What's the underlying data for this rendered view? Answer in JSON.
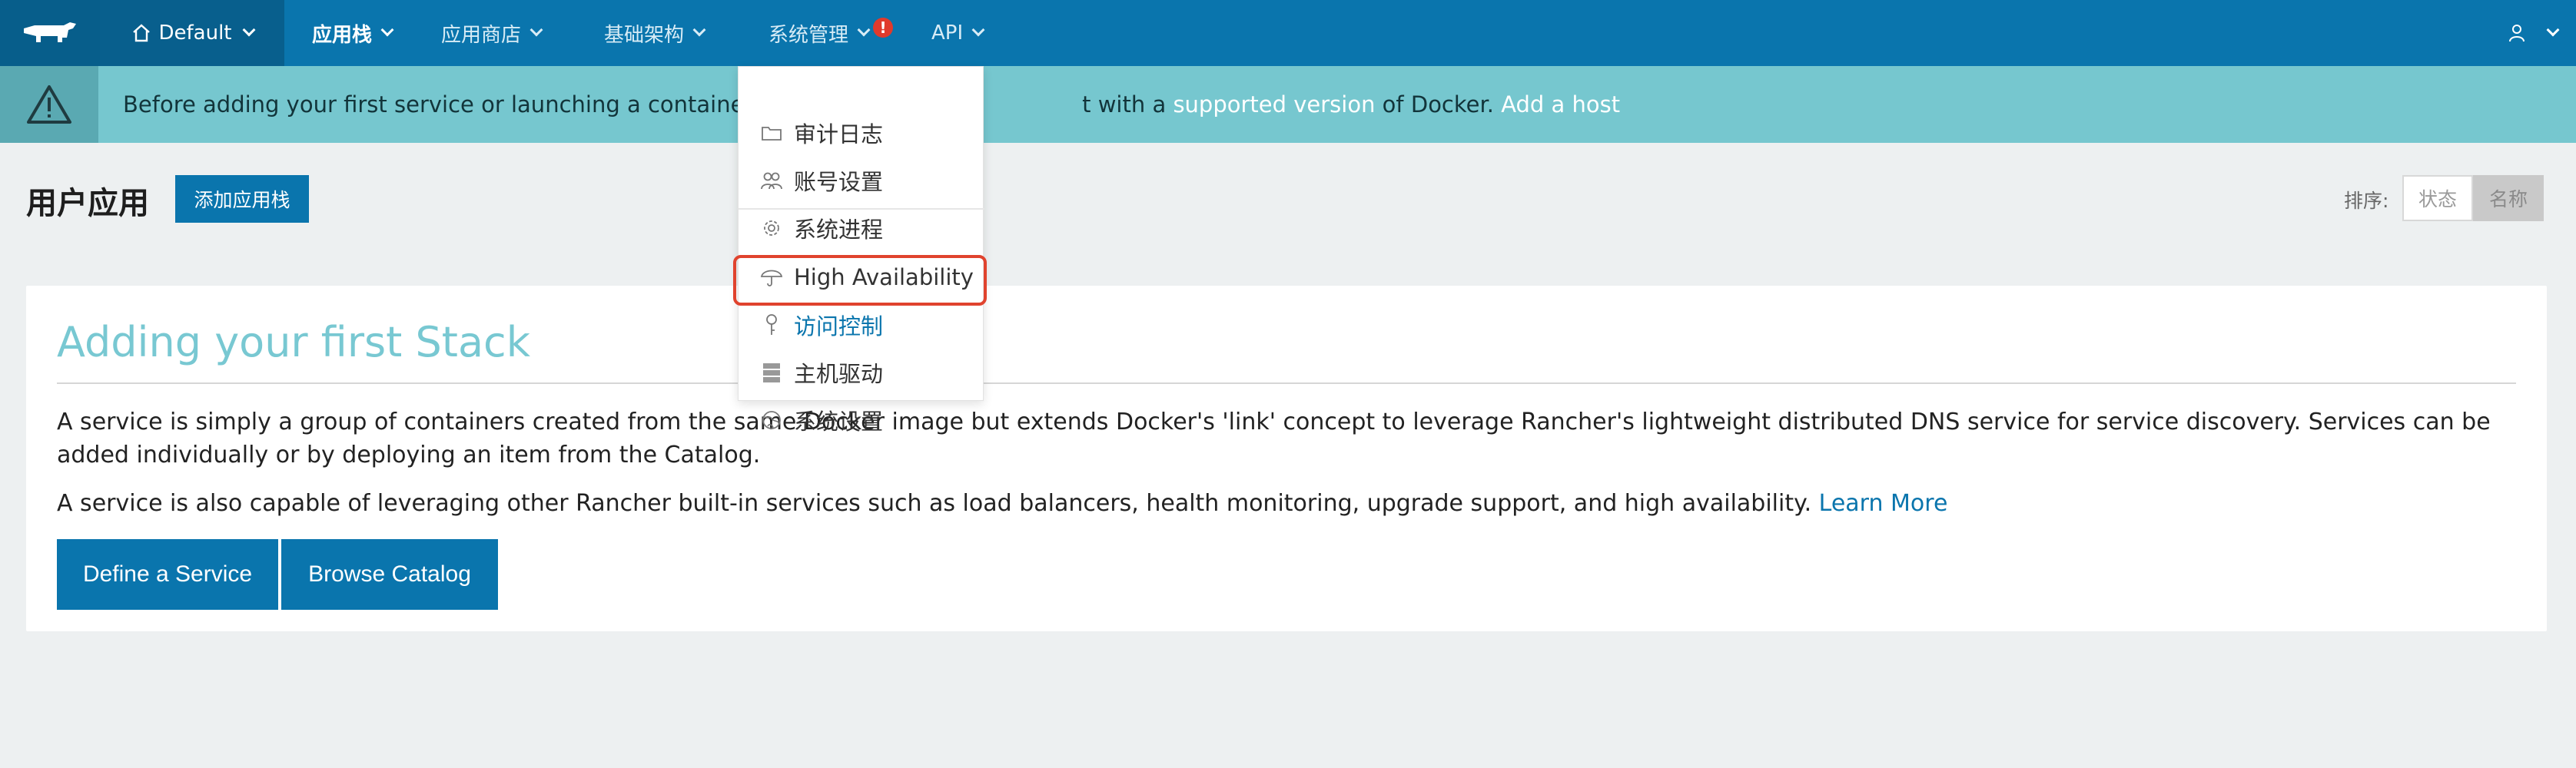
{
  "nav": {
    "environment": "Default",
    "items": [
      {
        "label": "应用栈"
      },
      {
        "label": "应用商店"
      },
      {
        "label": "基础架构"
      },
      {
        "label": "系统管理"
      },
      {
        "label": "API"
      }
    ],
    "alert_badge": "!"
  },
  "banner": {
    "text_before": "Before adding your first service or launching a container, you'l",
    "text_mid": "t with a ",
    "link_supported": "supported version",
    "text_after": " of Docker. ",
    "link_add_host": "Add a host"
  },
  "page": {
    "title": "用户应用",
    "add_stack_label": "添加应用栈",
    "sort_label": "排序:",
    "sort_options": [
      "状态",
      "名称"
    ]
  },
  "card": {
    "title": "Adding your first Stack",
    "paragraph1": "A service is simply a group of containers created from the same Docker image but extends Docker's 'link' concept to leverage Rancher's lightweight distributed DNS service for service discovery. Services can be added individually or by deploying an item from the Catalog.",
    "paragraph2": "A service is also capable of leveraging other Rancher built-in services such as load balancers, health monitoring, upgrade support, and high availability. ",
    "learn_more": "Learn More",
    "define_service": "Define a Service",
    "browse_catalog": "Browse Catalog"
  },
  "dropdown": {
    "items": [
      {
        "label": "审计日志",
        "icon": "folder-icon"
      },
      {
        "label": "账号设置",
        "icon": "users-icon"
      },
      {
        "label": "系统进程",
        "icon": "gear-icon"
      },
      {
        "label": "High Availability",
        "icon": "umbrella-icon"
      },
      {
        "label": "访问控制",
        "icon": "key-icon"
      },
      {
        "label": "主机驱动",
        "icon": "server-icon"
      },
      {
        "label": "系统设置",
        "icon": "globe-icon"
      }
    ]
  },
  "colors": {
    "primary": "#0a75ad",
    "banner": "#76c7cf",
    "title_accent": "#78c8d2",
    "highlight_border": "#e0432e"
  }
}
